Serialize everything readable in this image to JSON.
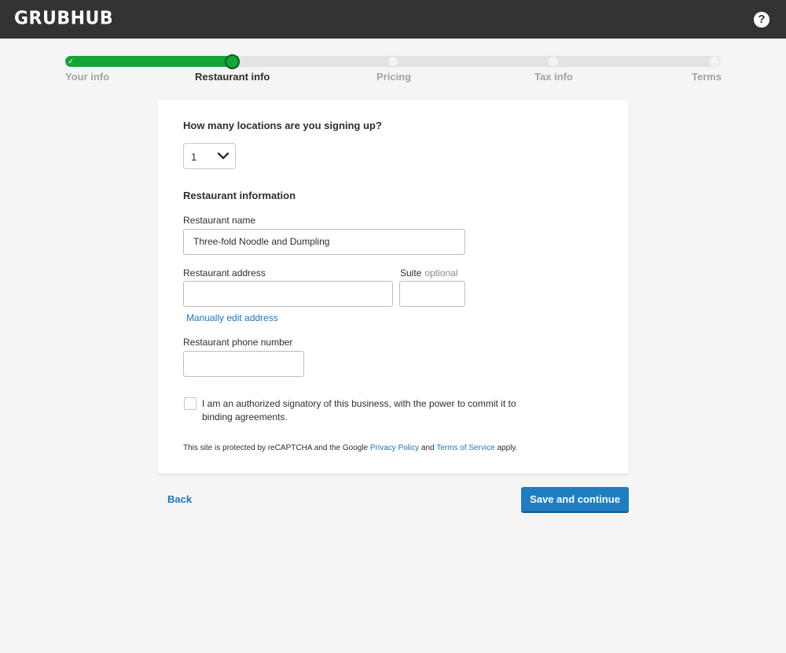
{
  "header": {
    "logo": "GRUBHUB",
    "help_icon": "question-circle-icon",
    "help_glyph": "?"
  },
  "progress": {
    "steps": [
      {
        "label": "Your info",
        "state": "done"
      },
      {
        "label": "Restaurant info",
        "state": "current"
      },
      {
        "label": "Pricing",
        "state": "upcoming"
      },
      {
        "label": "Tax info",
        "state": "upcoming"
      },
      {
        "label": "Terms",
        "state": "upcoming"
      }
    ],
    "completed_fraction": 0.25
  },
  "form": {
    "locations_question": "How many locations are you signing up?",
    "locations_value": "1",
    "section_title": "Restaurant information",
    "name_label": "Restaurant name",
    "name_value": "Three-fold Noodle and Dumpling",
    "address_label": "Restaurant address",
    "address_value": "",
    "suite_label": "Suite",
    "suite_optional": "optional",
    "suite_value": "",
    "manual_edit_link": "Manually edit address",
    "phone_label": "Restaurant phone number",
    "phone_value": "",
    "signatory_checked": false,
    "signatory_text": "I am an authorized signatory of this business, with the power to commit it to binding agreements.",
    "recaptcha": {
      "prefix": "This site is protected by reCAPTCHA and the Google ",
      "privacy_link": "Privacy Policy",
      "and": " and ",
      "terms_link": "Terms of Service",
      "suffix": " apply."
    }
  },
  "actions": {
    "back_label": "Back",
    "continue_label": "Save and continue"
  },
  "colors": {
    "header_bg": "#333333",
    "progress_green": "#13a538",
    "link_blue": "#1877c0",
    "button_blue": "#1f7ec2",
    "page_bg": "#f5f5f5"
  }
}
